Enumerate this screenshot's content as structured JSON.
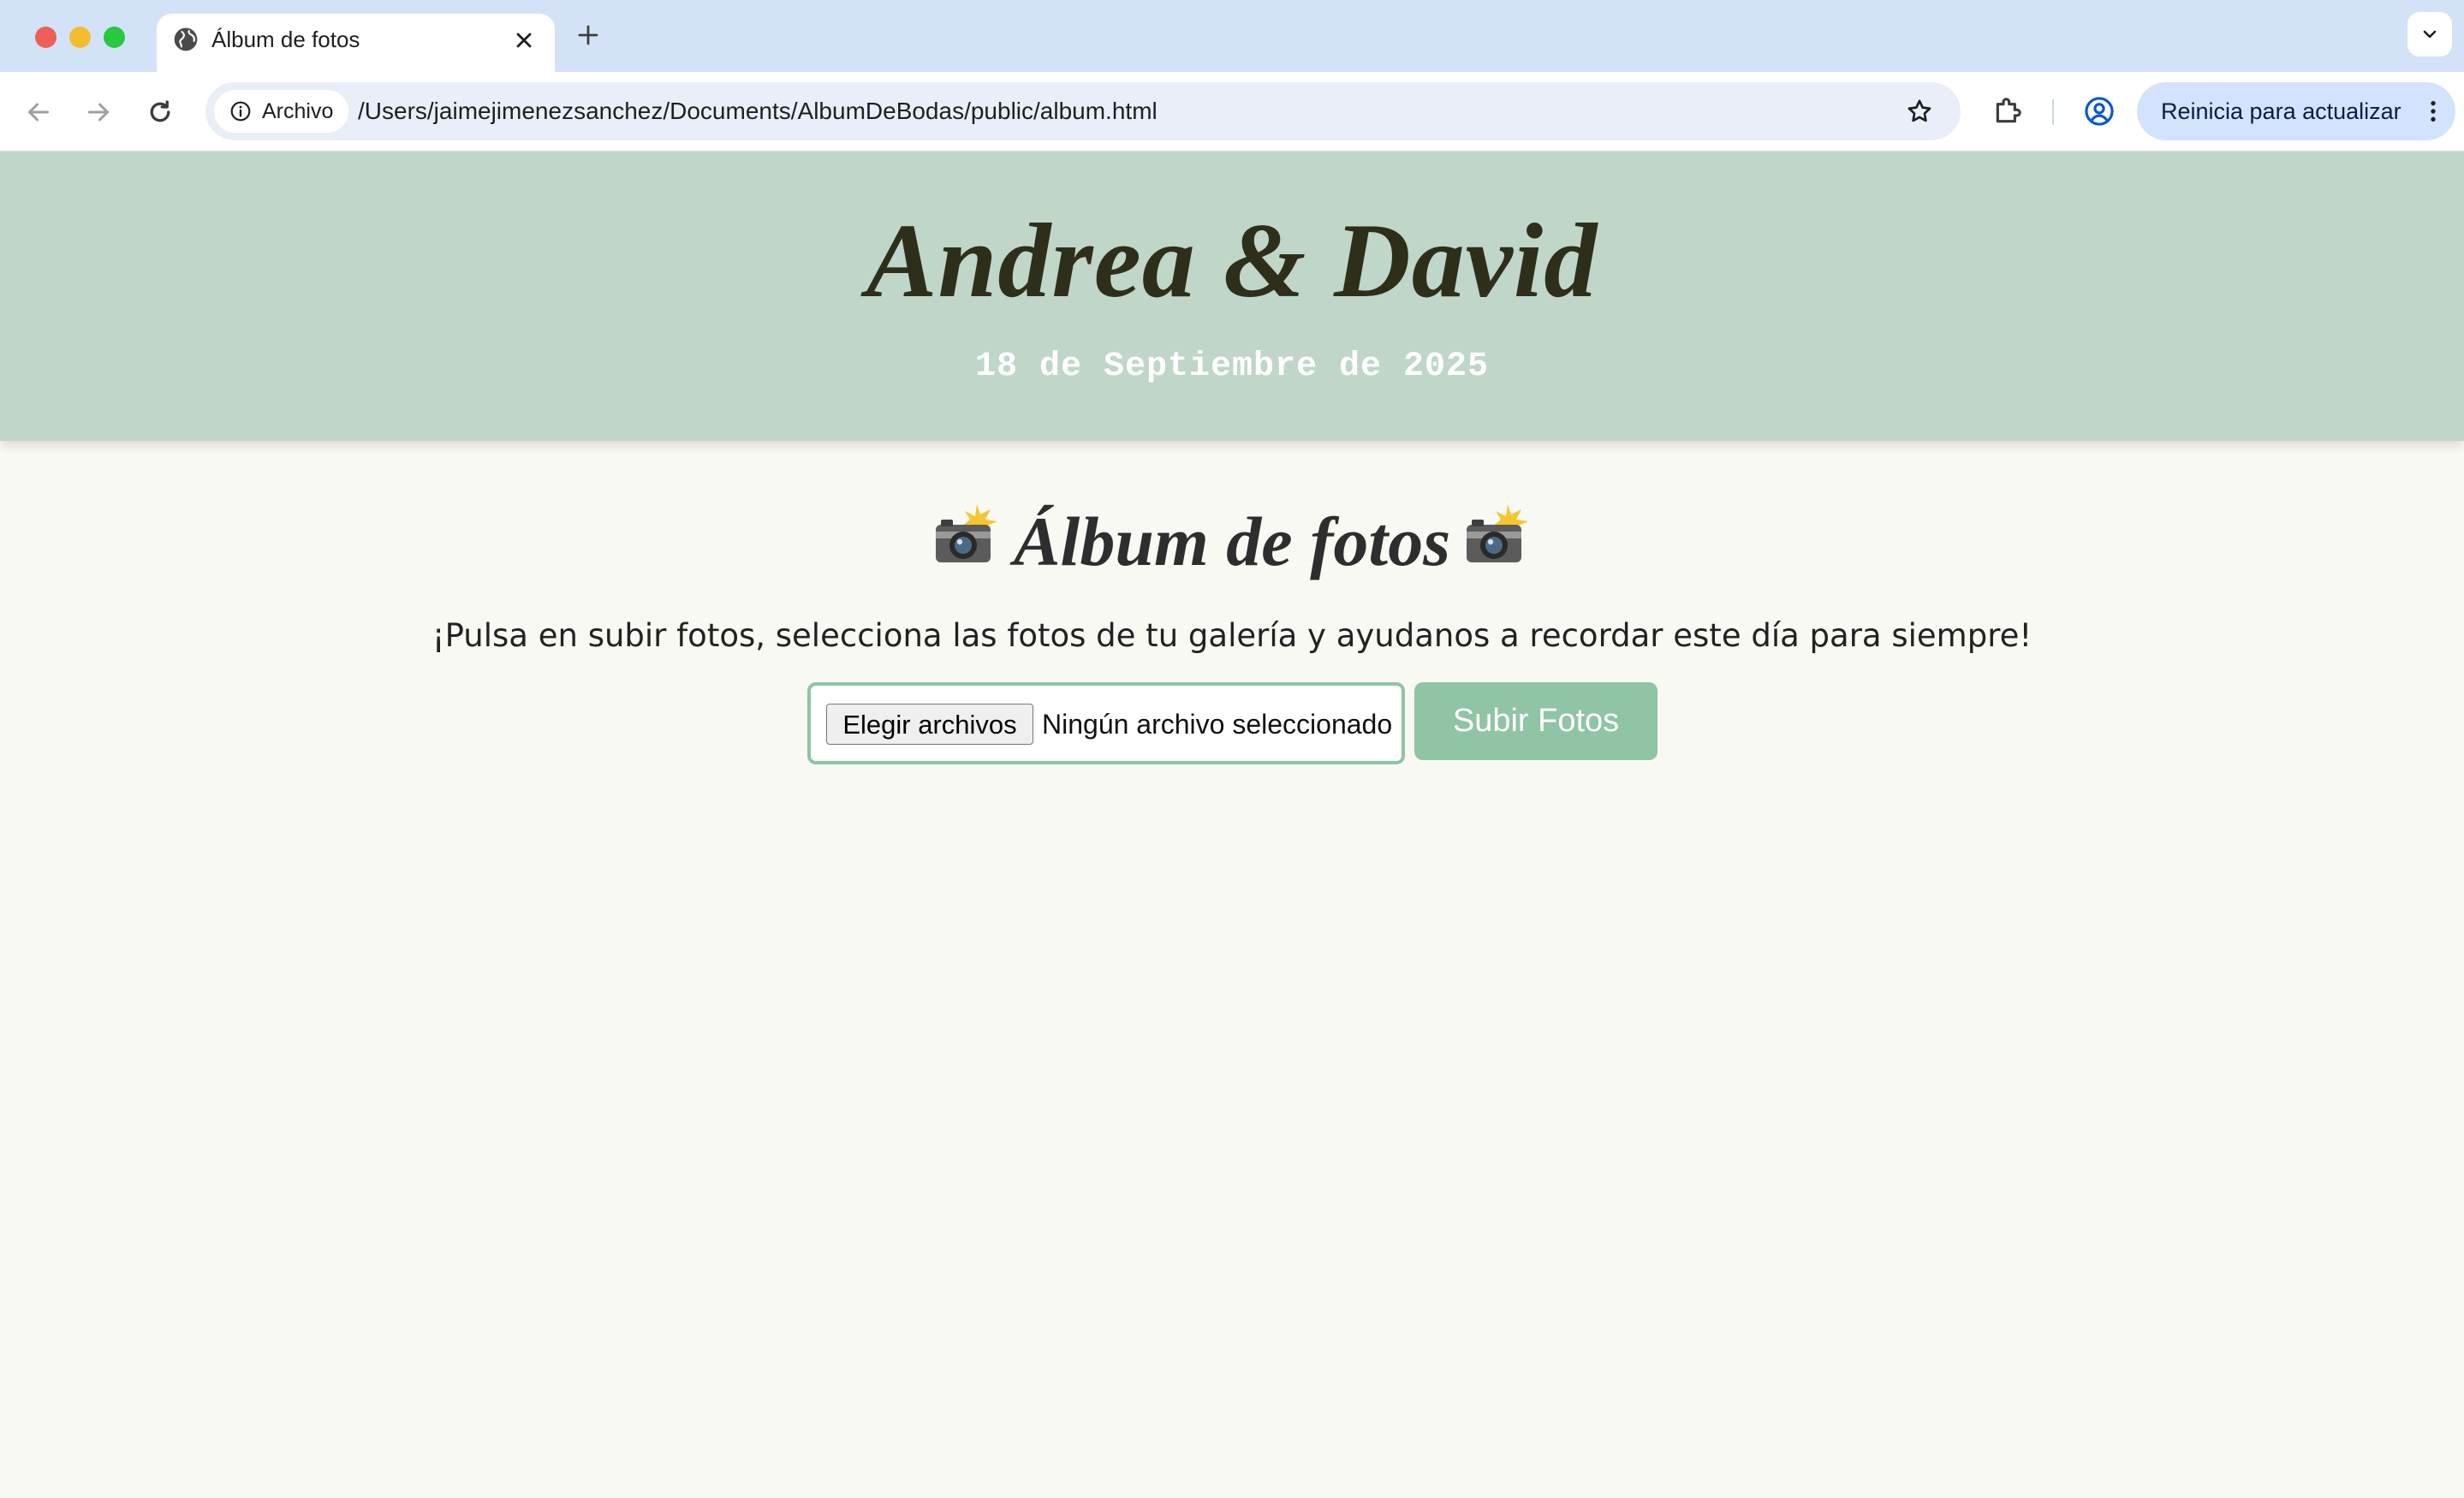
{
  "browser": {
    "tab": {
      "title": "Álbum de fotos"
    },
    "address_bar": {
      "security_label": "Archivo",
      "url": "/Users/jaimejimenezsanchez/Documents/AlbumDeBodas/public/album.html"
    },
    "update_button_label": "Reinicia para actualizar",
    "icons": {
      "back": "arrow-left-icon",
      "forward": "arrow-right-icon",
      "reload": "reload-icon",
      "bookmark": "star-icon",
      "extensions": "puzzle-icon",
      "profile": "account-circle-icon",
      "menu": "kebab-menu-icon",
      "new_tab": "plus-icon",
      "tab_close": "close-icon",
      "tab_list": "chevron-down-icon",
      "site_info": "info-icon",
      "favicon": "globe-icon"
    }
  },
  "page": {
    "hero": {
      "title": "Andrea & David",
      "date": "18 de Septiembre de 2025"
    },
    "album": {
      "heading": "Álbum de fotos",
      "heading_icon": "camera-flash-icon",
      "instructions": "¡Pulsa en subir fotos, selecciona las fotos de tu galería y ayudanos a recordar este día para siempre!",
      "file_input": {
        "button_label": "Elegir archivos",
        "status": "Ningún archivo seleccionado"
      },
      "upload_button_label": "Subir Fotos"
    }
  },
  "colors": {
    "hero_background": "#bfd6c9",
    "accent_green": "#8fc4a4",
    "page_background": "#f9f9f4",
    "title_text": "#2d2f1a"
  }
}
